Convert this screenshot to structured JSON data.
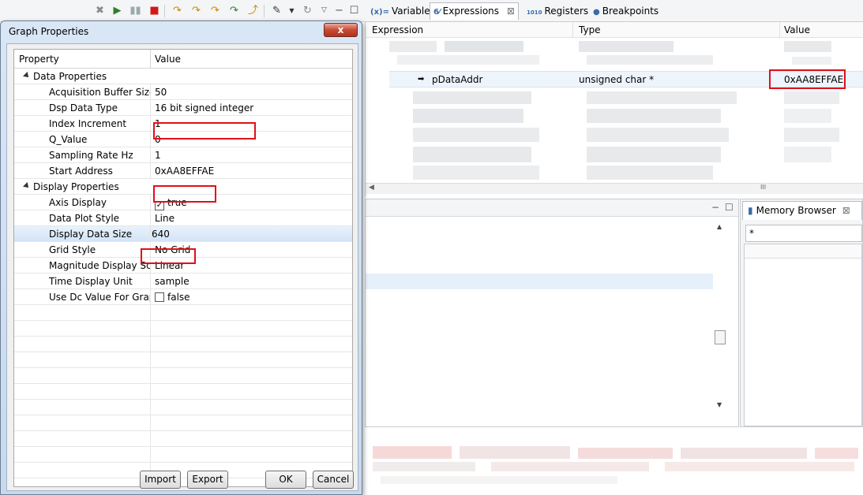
{
  "dialog": {
    "title": "Graph Properties",
    "close_label": "x",
    "columns": {
      "property": "Property",
      "value": "Value"
    },
    "data_properties": {
      "label": "Data Properties",
      "rows": [
        {
          "name": "Acquisition Buffer Size",
          "value": "50"
        },
        {
          "name": "Dsp Data Type",
          "value": "16 bit signed integer"
        },
        {
          "name": "Index Increment",
          "value": "1"
        },
        {
          "name": "Q_Value",
          "value": "0"
        },
        {
          "name": "Sampling Rate Hz",
          "value": "1"
        },
        {
          "name": "Start Address",
          "value": "0xAA8EFFAE"
        }
      ]
    },
    "display_properties": {
      "label": "Display Properties",
      "rows": [
        {
          "name": "Axis Display",
          "value": "true",
          "check": "✓"
        },
        {
          "name": "Data Plot Style",
          "value": "Line"
        },
        {
          "name": "Display Data Size",
          "value": "640"
        },
        {
          "name": "Grid Style",
          "value": "No Grid"
        },
        {
          "name": "Magnitude Display Scale",
          "value": "Linear"
        },
        {
          "name": "Time Display Unit",
          "value": "sample"
        },
        {
          "name": "Use Dc Value For Graph",
          "value": "false",
          "check": ""
        }
      ]
    },
    "buttons": {
      "import": "Import",
      "export": "Export",
      "ok": "OK",
      "cancel": "Cancel"
    }
  },
  "tabs": [
    {
      "icon": "(x)=",
      "label": "Variables"
    },
    {
      "icon": "6⁄",
      "label": "Expressions",
      "close": "⊠"
    },
    {
      "icon": "1010",
      "label": "Registers"
    },
    {
      "icon": "●",
      "label": "Breakpoints"
    }
  ],
  "expressions": {
    "columns": {
      "expression": "Expression",
      "type": "Type",
      "value": "Value"
    },
    "row": {
      "arrow": "➡",
      "expression": "pDataAddr",
      "type": "unsigned char *",
      "value": "0xAA8EFFAE"
    },
    "hscroll_mark": "III"
  },
  "memory": {
    "tab_label": "Memory Browser",
    "tab_close": "⊠",
    "input_value": "*"
  },
  "lower_pane": {
    "min": "−",
    "max": "☐"
  },
  "colors": {
    "highlight_box": "#e0101a",
    "selection": "#d3e4f7"
  },
  "icons": {
    "toolbar": [
      "remove-all-icon",
      "resume-icon",
      "suspend-icon",
      "terminate-icon",
      "step-into-icon",
      "step-over-icon",
      "step-return-icon",
      "assembly-step-icon",
      "reset-icon",
      "target-config-icon",
      "restart-icon",
      "minimize-icon",
      "maximize-icon"
    ]
  }
}
